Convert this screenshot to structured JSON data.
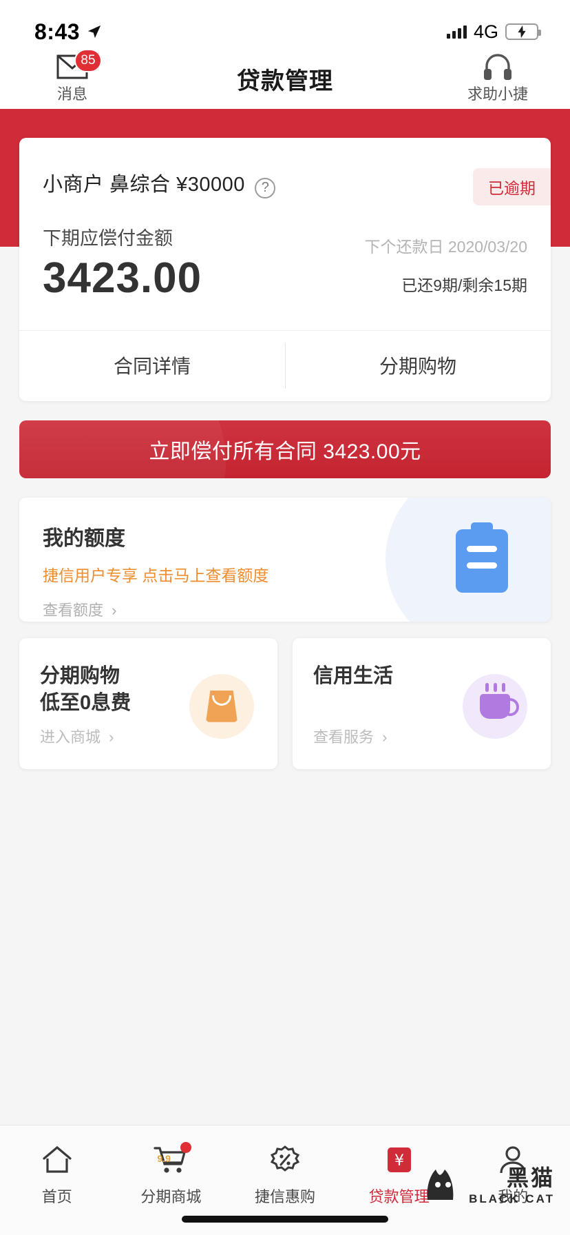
{
  "status_bar": {
    "time": "8:43",
    "network": "4G",
    "location_icon": "location-arrow-icon",
    "signal_icon": "signal-bars-icon",
    "battery_icon": "battery-charging-icon"
  },
  "nav": {
    "title": "贷款管理",
    "left": {
      "label": "消息",
      "badge": "85",
      "icon": "envelope-icon"
    },
    "right": {
      "label": "求助小捷",
      "icon": "headset-icon"
    }
  },
  "loan_card": {
    "product_title": "小商户 鼻综合 ¥30000",
    "help_icon": "question-mark-icon",
    "status_badge": "已逾期",
    "next_amount_label": "下期应偿付金额",
    "next_amount": "3423.00",
    "due_date_label": "下个还款日",
    "due_date": "2020/03/20",
    "installment_info": "已还9期/剩余15期",
    "tabs": [
      {
        "label": "合同详情"
      },
      {
        "label": "分期购物"
      }
    ]
  },
  "cta": {
    "label": "立即偿付所有合同 3423.00元"
  },
  "quota_card": {
    "title": "我的额度",
    "subtitle": "捷信用户专享 点击马上查看额度",
    "link": "查看额度",
    "chevron": "›",
    "icon": "document-icon"
  },
  "promo_cards": [
    {
      "title_line1": "分期购物",
      "title_line2": "低至0息费",
      "link": "进入商城",
      "chevron": "›",
      "icon": "shopping-bag-icon"
    },
    {
      "title_line1": "信用生活",
      "title_line2": "",
      "link": "查看服务",
      "chevron": "›",
      "icon": "coffee-cup-icon"
    }
  ],
  "tabbar": [
    {
      "label": "首页",
      "icon": "home-icon",
      "active": false
    },
    {
      "label": "分期商城",
      "icon": "cart-icon",
      "active": false,
      "badge": "9.9"
    },
    {
      "label": "捷信惠购",
      "icon": "ticket-icon",
      "active": false
    },
    {
      "label": "贷款管理",
      "icon": "yuan-card-icon",
      "active": true
    },
    {
      "label": "我的",
      "icon": "person-icon",
      "active": false
    }
  ],
  "watermark": {
    "cn": "黑猫",
    "en": "BLACK CAT"
  },
  "colors": {
    "brand_red": "#cf2b38",
    "badge_bg": "#fbeaea",
    "orange": "#ef8d2e",
    "page_bg": "#f5f5f5"
  }
}
